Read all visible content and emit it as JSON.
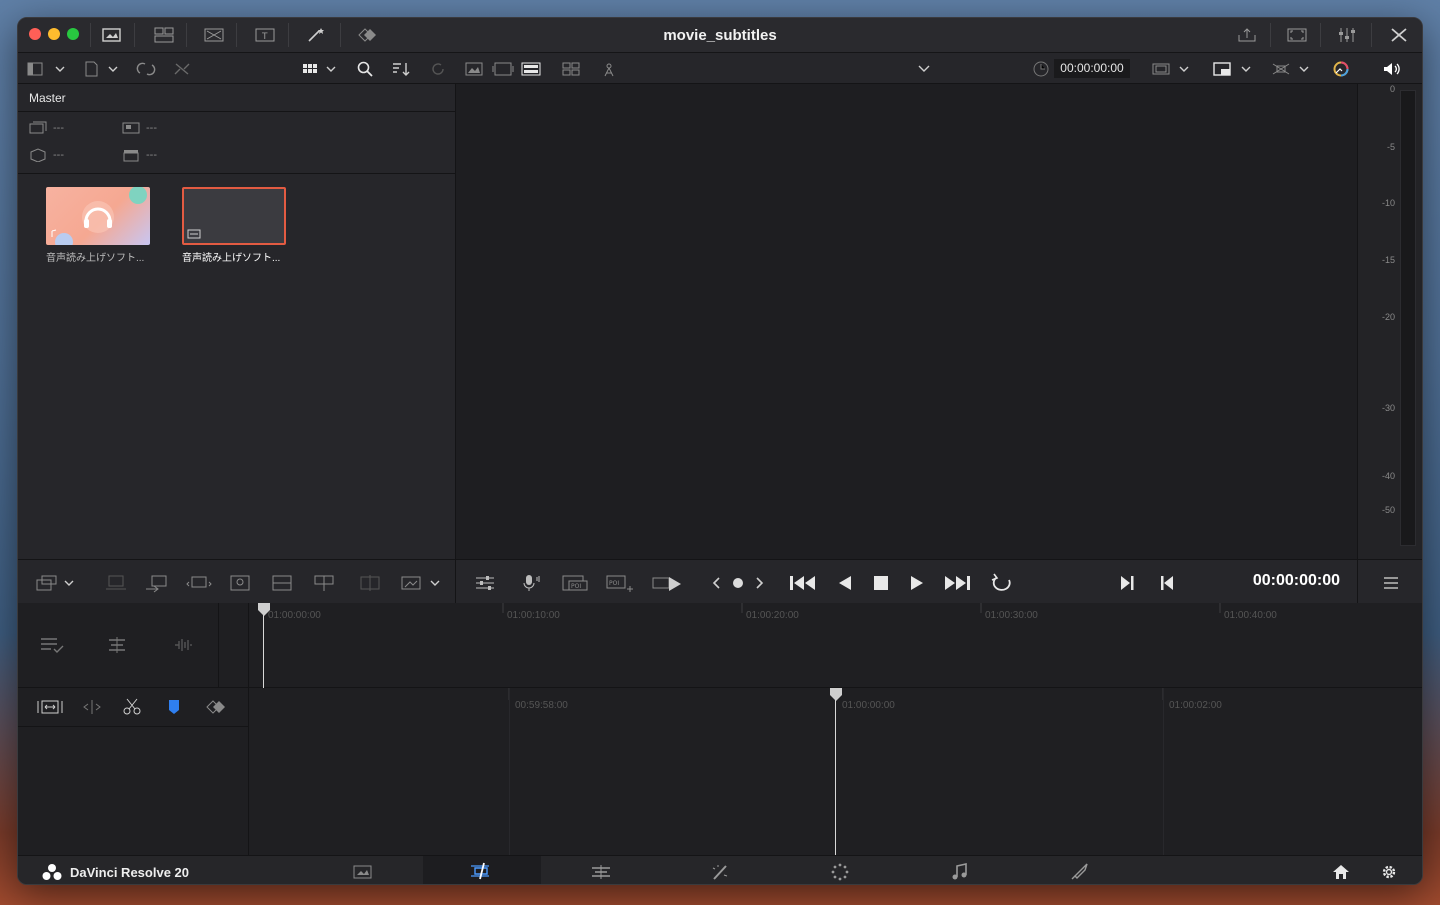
{
  "window": {
    "title": "movie_subtitles"
  },
  "media_pool": {
    "header": "Master",
    "metadata_values": [
      "---",
      "---",
      "---",
      "---"
    ],
    "clips": [
      {
        "label": "音声読み上げソフト...",
        "selected": false
      },
      {
        "label": "音声読み上げソフト...",
        "selected": true
      }
    ]
  },
  "viewer": {
    "source_timecode": "00:00:00:00",
    "record_timecode": "00:00:00:00"
  },
  "audio_meter": {
    "ticks": [
      "0",
      "-5",
      "-10",
      "-15",
      "-20",
      "-30",
      "-40",
      "-50"
    ]
  },
  "timeline": {
    "upper_ruler": [
      "01:00:00:00",
      "01:00:10:00",
      "01:00:20:00",
      "01:00:30:00",
      "01:00:40:00"
    ],
    "lower_ruler": [
      "00:59:58:00",
      "01:00:00:00",
      "01:00:02:00"
    ]
  },
  "bottom_bar": {
    "brand": "DaVinci Resolve 20",
    "pages": [
      "media",
      "cut",
      "edit",
      "fusion",
      "color",
      "fairlight",
      "deliver"
    ],
    "active_page": "cut"
  },
  "colors": {
    "accent_red": "#e84a3a",
    "marker_blue": "#2f7ff0"
  }
}
